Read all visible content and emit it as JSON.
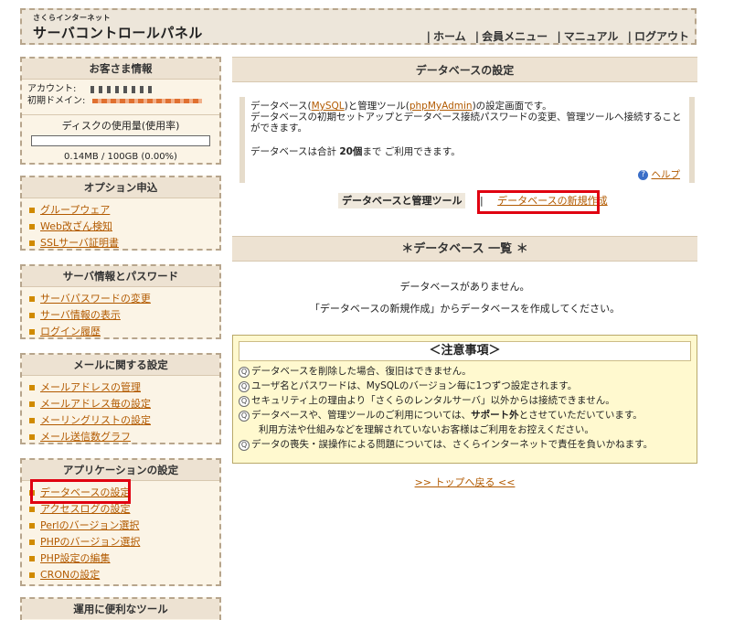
{
  "header": {
    "brand_small": "さくらインターネット",
    "brand_main": "サーバコントロールパネル",
    "nav": [
      "ホーム",
      "会員メニュー",
      "マニュアル",
      "ログアウト"
    ]
  },
  "sidebar": {
    "customer": {
      "title": "お客さま情報",
      "account_label": "アカウント:",
      "domain_label": "初期ドメイン:",
      "disk_label": "ディスクの使用量(使用率)",
      "disk_value": "0.14MB / 100GB (0.00%)",
      "disk_usage_fraction": 0.0
    },
    "options": {
      "title": "オプション申込",
      "items": [
        "グループウェア",
        "Web改ざん検知",
        "SSLサーバ証明書"
      ]
    },
    "server": {
      "title": "サーバ情報とパスワード",
      "items": [
        "サーバパスワードの変更",
        "サーバ情報の表示",
        "ログイン履歴"
      ]
    },
    "mail": {
      "title": "メールに関する設定",
      "items": [
        "メールアドレスの管理",
        "メールアドレス毎の設定",
        "メーリングリストの設定",
        "メール送信数グラフ"
      ]
    },
    "apps": {
      "title": "アプリケーションの設定",
      "items": [
        "データベースの設定",
        "アクセスログの設定",
        "Perlのバージョン選択",
        "PHPのバージョン選択",
        "PHP設定の編集",
        "CRONの設定"
      ]
    },
    "tools": {
      "title": "運用に便利なツール"
    }
  },
  "main": {
    "title": "データベースの設定",
    "desc": {
      "l1_a": "データベース(",
      "l1_link1": "MySQL",
      "l1_b": ")と管理ツール(",
      "l1_link2": "phpMyAdmin",
      "l1_c": ")の設定画面です。",
      "l2": "データベースの初期セットアップとデータベース接続パスワードの変更、管理ツールへ接続することができます。",
      "l3_a": "データベースは合計 ",
      "l3_b": "20個",
      "l3_c": "まで ご利用できます。",
      "help": "ヘルプ"
    },
    "subnav": {
      "current": "データベースと管理ツール",
      "link": "データベースの新規作成"
    },
    "list_title": "＊データベース 一覧 ＊",
    "empty1": "データベースがありません。",
    "empty2": "「データベースの新規作成」からデータベースを作成してください。",
    "notes": {
      "title": "＜注意事項＞",
      "n1": "データベースを削除した場合、復旧はできません。",
      "n2": "ユーザ名とパスワードは、MySQLのバージョン毎に1つずつ設定されます。",
      "n3": "セキュリティ上の理由より「さくらのレンタルサーバ」以外からは接続できません。",
      "n4_a": "データベースや、管理ツールのご利用については、",
      "n4_b": "サポート外",
      "n4_c": "とさせていただいています。",
      "n4_cont": "利用方法や仕組みなどを理解されていないお客様はご利用をお控えください。",
      "n5": "データの喪失・誤操作による問題については、さくらインターネットで責任を負いかねます。"
    },
    "top_link": ">> トップへ戻る <<"
  }
}
